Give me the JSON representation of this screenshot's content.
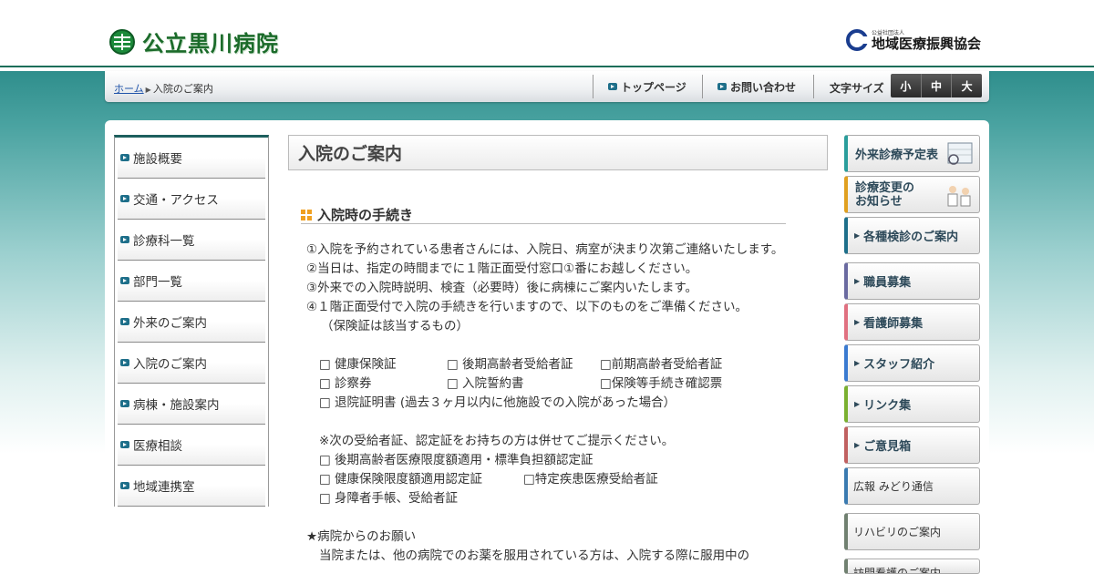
{
  "header": {
    "hospital_name": "公立黒川病院",
    "org_small": "公益社団法人",
    "org_name": "地域医療振興協会"
  },
  "navbar": {
    "breadcrumb_home": "ホーム",
    "breadcrumb_current": "入院のご案内",
    "top_page": "トップページ",
    "contact": "お問い合わせ",
    "font_size_label": "文字サイズ",
    "font_small": "小",
    "font_medium": "中",
    "font_large": "大"
  },
  "sidebar": {
    "items": [
      {
        "label": "施設概要"
      },
      {
        "label": "交通・アクセス"
      },
      {
        "label": "診療科一覧"
      },
      {
        "label": "部門一覧"
      },
      {
        "label": "外来のご案内"
      },
      {
        "label": "入院のご案内"
      },
      {
        "label": "病棟・施設案内"
      },
      {
        "label": "医療相談"
      },
      {
        "label": "地域連携室"
      }
    ]
  },
  "content": {
    "page_title": "入院のご案内",
    "section_title": "入院時の手続き",
    "p1": "①入院を予約されている患者さんには、入院日、病室が決まり次第ご連絡いたします。",
    "p2": "②当日は、指定の時間までに１階正面受付窓口①番にお越しください。",
    "p3": "③外来での入院時説明、検査（必要時）後に病棟にご案内いたします。",
    "p4": "④１階正面受付で入院の手続きを行いますので、以下のものをご準備ください。",
    "p4_note": "（保険証は該当するもの）",
    "check1a": "□ 健康保険証",
    "check1b": "□ 後期高齢者受給者証",
    "check1c": "□前期高齢者受給者証",
    "check2a": "□ 診察券",
    "check2b": "□ 入院誓約書",
    "check2c": "□保険等手続き確認票",
    "check3": "□ 退院証明書 (過去３ヶ月以内に他施設での入院があった場合）",
    "note": "※次の受給者証、認定証をお持ちの方は併せてご提示ください。",
    "cert1": "□ 後期高齢者医療限度額適用・標準負担額認定証",
    "cert2a": "□ 健康保険限度額適用認定証",
    "cert2b": "□特定疾患医療受給者証",
    "cert3": "□ 身障者手帳、受給者証",
    "request_head": "★病院からのお願い",
    "request_text": "当院または、他の病院でのお薬を服用されている方は、入院する際に服用中の"
  },
  "rightbar": {
    "schedule": "外来診療予定表",
    "change_line1": "診療変更の",
    "change_line2": "お知らせ",
    "checkup": "各種検診のご案内",
    "recruit": "職員募集",
    "nurse": "看護師募集",
    "staff": "スタッフ紹介",
    "links": "リンク集",
    "opinion": "ご意見箱",
    "newsletter": "広報 みどり通信",
    "rehab": "リハビリのご案内",
    "visit": "訪問看護のご案内"
  }
}
